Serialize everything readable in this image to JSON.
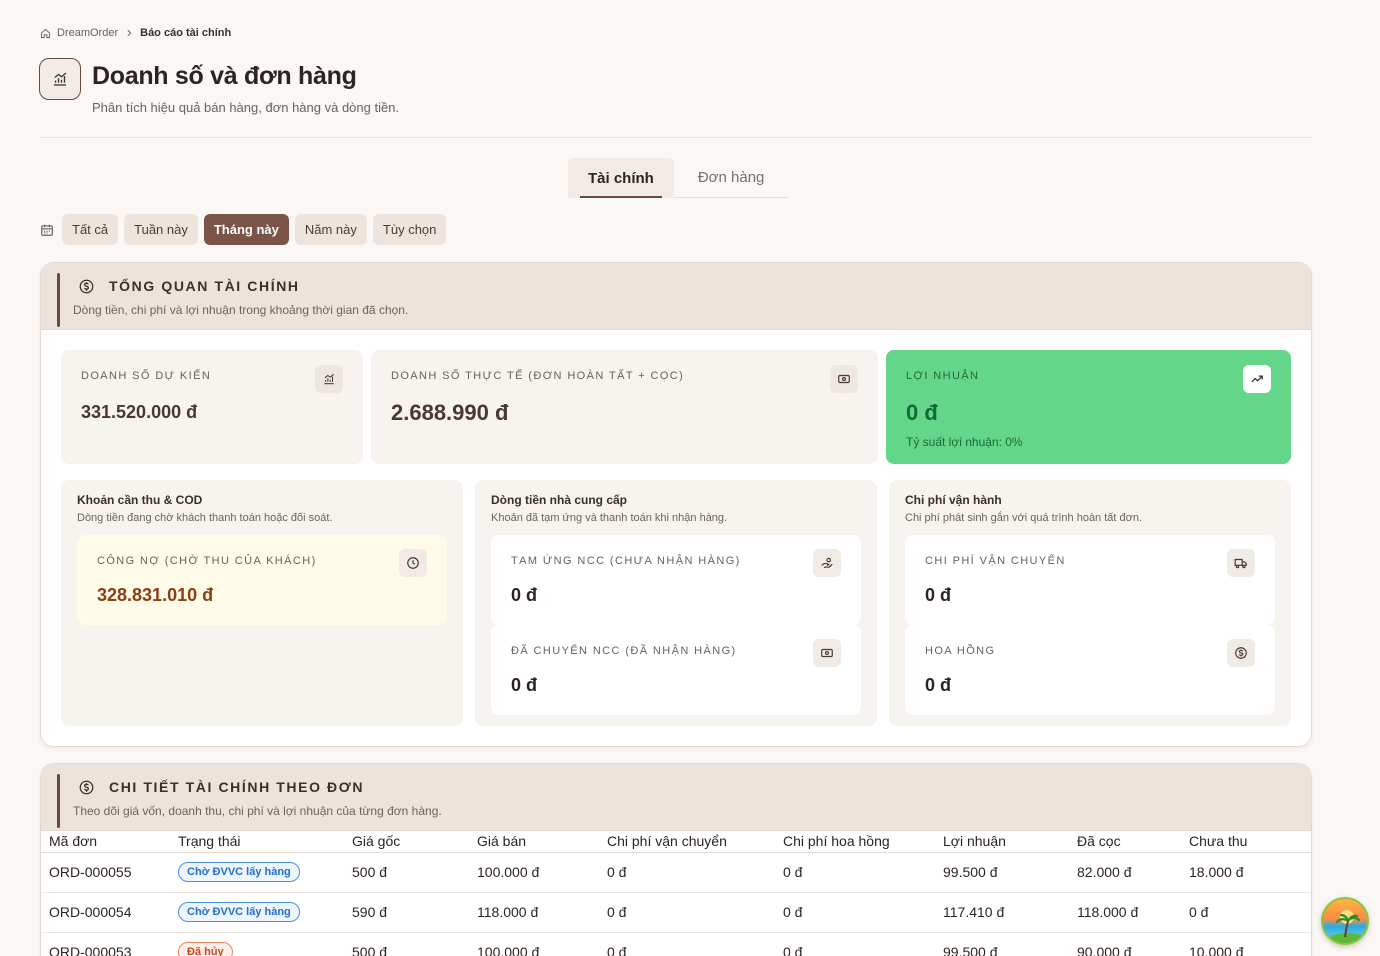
{
  "breadcrumb": {
    "home": "DreamOrder",
    "current": "Báo cáo tài chính"
  },
  "page": {
    "title": "Doanh số và đơn hàng",
    "subtitle": "Phân tích hiệu quả bán hàng, đơn hàng và dòng tiền."
  },
  "tabs": [
    {
      "label": "Tài chính",
      "active": true
    },
    {
      "label": "Đơn hàng",
      "active": false
    }
  ],
  "filters": [
    {
      "label": "Tất cả",
      "active": false
    },
    {
      "label": "Tuần này",
      "active": false
    },
    {
      "label": "Tháng này",
      "active": true
    },
    {
      "label": "Năm này",
      "active": false
    },
    {
      "label": "Tùy chọn",
      "active": false
    }
  ],
  "overview": {
    "title": "TỔNG QUAN TÀI CHÍNH",
    "subtitle": "Dòng tiền, chi phí và lợi nhuận trong khoảng thời gian đã chọn.",
    "expected": {
      "label": "DOANH SỐ DỰ KIẾN",
      "value": "331.520.000 đ"
    },
    "actual": {
      "label": "DOANH SỐ THỰC TẾ (ĐƠN HOÀN TẤT + CỌC)",
      "value": "2.688.990 đ"
    },
    "profit": {
      "label": "LỢI NHUẬN",
      "value": "0 đ",
      "ratio": "Tỷ suất lợi nhuận: 0%"
    },
    "receivables": {
      "title": "Khoản cần thu & COD",
      "subtitle": "Dòng tiền đang chờ khách thanh toán hoặc đối soát.",
      "debt": {
        "label": "CÔNG NỢ (CHỜ THU CỦA KHÁCH)",
        "value": "328.831.010 đ"
      }
    },
    "supplier": {
      "title": "Dòng tiền nhà cung cấp",
      "subtitle": "Khoản đã tạm ứng và thanh toán khi nhận hàng.",
      "advance": {
        "label": "TẠM ỨNG NCC (CHƯA NHẬN HÀNG)",
        "value": "0 đ"
      },
      "paid": {
        "label": "ĐÃ CHUYỂN NCC (ĐÃ NHẬN HÀNG)",
        "value": "0 đ"
      }
    },
    "operating": {
      "title": "Chi phí vận hành",
      "subtitle": "Chi phí phát sinh gắn với quá trình hoàn tất đơn.",
      "shipping": {
        "label": "CHI PHÍ VẬN CHUYỂN",
        "value": "0 đ"
      },
      "commission": {
        "label": "HOA HỒNG",
        "value": "0 đ"
      }
    }
  },
  "details": {
    "title": "CHI TIẾT TÀI CHÍNH THEO ĐƠN",
    "subtitle": "Theo dõi giá vốn, doanh thu, chi phí và lợi nhuận của từng đơn hàng.",
    "columns": [
      "Mã đơn",
      "Trạng thái",
      "Giá gốc",
      "Giá bán",
      "Chi phí vận chuyển",
      "Chi phí hoa hồng",
      "Lợi nhuận",
      "Đã cọc",
      "Chưa thu"
    ],
    "rows": [
      {
        "id": "ORD-000055",
        "status": "Chờ ĐVVC lấy hàng",
        "status_color": "#1e6fd0",
        "cost": "500 đ",
        "price": "100.000 đ",
        "shipping": "0 đ",
        "commission": "0 đ",
        "profit": "99.500 đ",
        "deposit": "82.000 đ",
        "unpaid": "18.000 đ"
      },
      {
        "id": "ORD-000054",
        "status": "Chờ ĐVVC lấy hàng",
        "status_color": "#1e6fd0",
        "cost": "590 đ",
        "price": "118.000 đ",
        "shipping": "0 đ",
        "commission": "0 đ",
        "profit": "117.410 đ",
        "deposit": "118.000 đ",
        "unpaid": "0 đ"
      },
      {
        "id": "ORD-000053",
        "status": "Đã hủy",
        "status_color": "#c24a1f",
        "cost": "500 đ",
        "price": "100.000 đ",
        "shipping": "0 đ",
        "commission": "0 đ",
        "profit": "99.500 đ",
        "deposit": "90.000 đ",
        "unpaid": "10.000 đ"
      }
    ]
  },
  "colors": {
    "brand": "#7a5446",
    "profit_bg": "#63d68a",
    "debt_text": "#8a3e12",
    "page_bg": "#faf7f4"
  },
  "icons": [
    "home-icon",
    "chevron-right-icon",
    "chart-bar-icon",
    "calendar-icon",
    "dollar-circle-icon",
    "banknote-icon",
    "trending-up-icon",
    "clock-icon",
    "hand-coins-icon",
    "truck-icon"
  ]
}
